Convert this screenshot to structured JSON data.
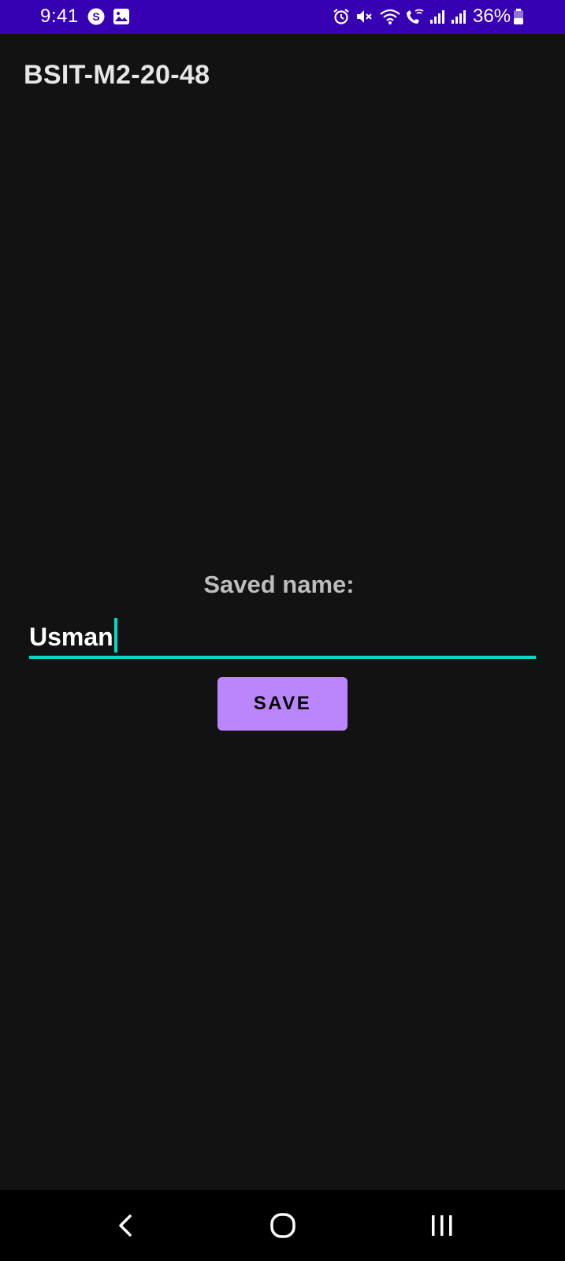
{
  "status_bar": {
    "time": "9:41",
    "battery": "36%",
    "icons": [
      "s-app-icon",
      "gallery-icon",
      "alarm-icon",
      "mute-icon",
      "wifi-icon",
      "wifi-call-icon",
      "signal-icon",
      "signal-icon",
      "battery-icon"
    ],
    "background": "#3700b3"
  },
  "app_bar": {
    "title": "BSIT-M2-20-48"
  },
  "main": {
    "saved_label": "Saved name:",
    "name_input": {
      "value": "Usman",
      "accent": "#03dac5"
    },
    "save_button": {
      "label": "SAVE",
      "color": "#bb86fc"
    }
  },
  "nav_bar": {
    "buttons": [
      "back-icon",
      "home-icon",
      "recents-icon"
    ]
  }
}
